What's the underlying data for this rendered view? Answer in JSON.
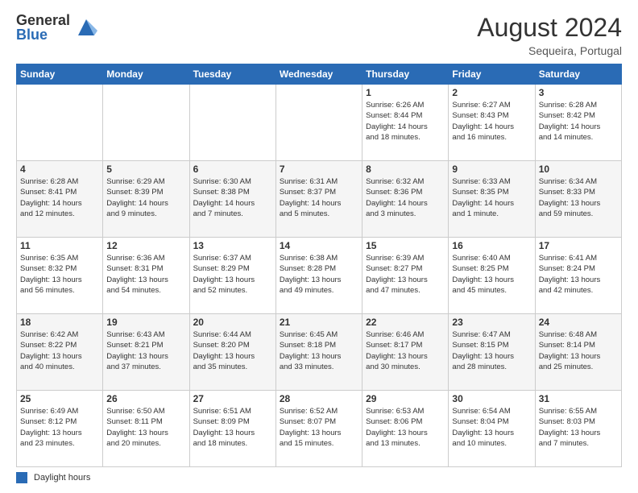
{
  "header": {
    "logo_general": "General",
    "logo_blue": "Blue",
    "title": "August 2024",
    "location": "Sequeira, Portugal"
  },
  "days_of_week": [
    "Sunday",
    "Monday",
    "Tuesday",
    "Wednesday",
    "Thursday",
    "Friday",
    "Saturday"
  ],
  "weeks": [
    [
      {
        "day": "",
        "info": ""
      },
      {
        "day": "",
        "info": ""
      },
      {
        "day": "",
        "info": ""
      },
      {
        "day": "",
        "info": ""
      },
      {
        "day": "1",
        "info": "Sunrise: 6:26 AM\nSunset: 8:44 PM\nDaylight: 14 hours\nand 18 minutes."
      },
      {
        "day": "2",
        "info": "Sunrise: 6:27 AM\nSunset: 8:43 PM\nDaylight: 14 hours\nand 16 minutes."
      },
      {
        "day": "3",
        "info": "Sunrise: 6:28 AM\nSunset: 8:42 PM\nDaylight: 14 hours\nand 14 minutes."
      }
    ],
    [
      {
        "day": "4",
        "info": "Sunrise: 6:28 AM\nSunset: 8:41 PM\nDaylight: 14 hours\nand 12 minutes."
      },
      {
        "day": "5",
        "info": "Sunrise: 6:29 AM\nSunset: 8:39 PM\nDaylight: 14 hours\nand 9 minutes."
      },
      {
        "day": "6",
        "info": "Sunrise: 6:30 AM\nSunset: 8:38 PM\nDaylight: 14 hours\nand 7 minutes."
      },
      {
        "day": "7",
        "info": "Sunrise: 6:31 AM\nSunset: 8:37 PM\nDaylight: 14 hours\nand 5 minutes."
      },
      {
        "day": "8",
        "info": "Sunrise: 6:32 AM\nSunset: 8:36 PM\nDaylight: 14 hours\nand 3 minutes."
      },
      {
        "day": "9",
        "info": "Sunrise: 6:33 AM\nSunset: 8:35 PM\nDaylight: 14 hours\nand 1 minute."
      },
      {
        "day": "10",
        "info": "Sunrise: 6:34 AM\nSunset: 8:33 PM\nDaylight: 13 hours\nand 59 minutes."
      }
    ],
    [
      {
        "day": "11",
        "info": "Sunrise: 6:35 AM\nSunset: 8:32 PM\nDaylight: 13 hours\nand 56 minutes."
      },
      {
        "day": "12",
        "info": "Sunrise: 6:36 AM\nSunset: 8:31 PM\nDaylight: 13 hours\nand 54 minutes."
      },
      {
        "day": "13",
        "info": "Sunrise: 6:37 AM\nSunset: 8:29 PM\nDaylight: 13 hours\nand 52 minutes."
      },
      {
        "day": "14",
        "info": "Sunrise: 6:38 AM\nSunset: 8:28 PM\nDaylight: 13 hours\nand 49 minutes."
      },
      {
        "day": "15",
        "info": "Sunrise: 6:39 AM\nSunset: 8:27 PM\nDaylight: 13 hours\nand 47 minutes."
      },
      {
        "day": "16",
        "info": "Sunrise: 6:40 AM\nSunset: 8:25 PM\nDaylight: 13 hours\nand 45 minutes."
      },
      {
        "day": "17",
        "info": "Sunrise: 6:41 AM\nSunset: 8:24 PM\nDaylight: 13 hours\nand 42 minutes."
      }
    ],
    [
      {
        "day": "18",
        "info": "Sunrise: 6:42 AM\nSunset: 8:22 PM\nDaylight: 13 hours\nand 40 minutes."
      },
      {
        "day": "19",
        "info": "Sunrise: 6:43 AM\nSunset: 8:21 PM\nDaylight: 13 hours\nand 37 minutes."
      },
      {
        "day": "20",
        "info": "Sunrise: 6:44 AM\nSunset: 8:20 PM\nDaylight: 13 hours\nand 35 minutes."
      },
      {
        "day": "21",
        "info": "Sunrise: 6:45 AM\nSunset: 8:18 PM\nDaylight: 13 hours\nand 33 minutes."
      },
      {
        "day": "22",
        "info": "Sunrise: 6:46 AM\nSunset: 8:17 PM\nDaylight: 13 hours\nand 30 minutes."
      },
      {
        "day": "23",
        "info": "Sunrise: 6:47 AM\nSunset: 8:15 PM\nDaylight: 13 hours\nand 28 minutes."
      },
      {
        "day": "24",
        "info": "Sunrise: 6:48 AM\nSunset: 8:14 PM\nDaylight: 13 hours\nand 25 minutes."
      }
    ],
    [
      {
        "day": "25",
        "info": "Sunrise: 6:49 AM\nSunset: 8:12 PM\nDaylight: 13 hours\nand 23 minutes."
      },
      {
        "day": "26",
        "info": "Sunrise: 6:50 AM\nSunset: 8:11 PM\nDaylight: 13 hours\nand 20 minutes."
      },
      {
        "day": "27",
        "info": "Sunrise: 6:51 AM\nSunset: 8:09 PM\nDaylight: 13 hours\nand 18 minutes."
      },
      {
        "day": "28",
        "info": "Sunrise: 6:52 AM\nSunset: 8:07 PM\nDaylight: 13 hours\nand 15 minutes."
      },
      {
        "day": "29",
        "info": "Sunrise: 6:53 AM\nSunset: 8:06 PM\nDaylight: 13 hours\nand 13 minutes."
      },
      {
        "day": "30",
        "info": "Sunrise: 6:54 AM\nSunset: 8:04 PM\nDaylight: 13 hours\nand 10 minutes."
      },
      {
        "day": "31",
        "info": "Sunrise: 6:55 AM\nSunset: 8:03 PM\nDaylight: 13 hours\nand 7 minutes."
      }
    ]
  ],
  "footer": {
    "legend_label": "Daylight hours"
  }
}
